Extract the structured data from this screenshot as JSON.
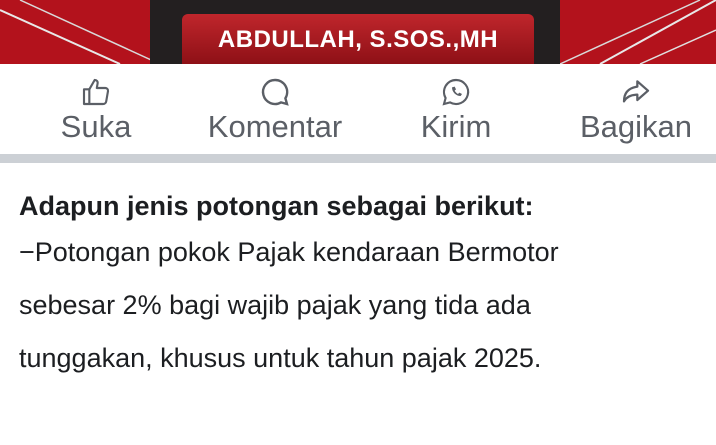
{
  "banner": {
    "name": "ABDULLAH, S.SOS.,MH"
  },
  "actions": [
    {
      "label": "Suka",
      "icon": "thumbs-up-icon"
    },
    {
      "label": "Komentar",
      "icon": "comment-bubble-icon"
    },
    {
      "label": "Kirim",
      "icon": "whatsapp-icon"
    },
    {
      "label": "Bagikan",
      "icon": "share-arrow-icon"
    }
  ],
  "post": {
    "heading": "Adapun jenis potongan sebagai berikut:",
    "lines": [
      "−Potongan pokok Pajak kendaraan Bermotor",
      "sebesar 2% bagi wajib pajak yang tida ada",
      "tunggakan, khusus untuk tahun pajak 2025."
    ]
  },
  "colors": {
    "banner_red": "#b3121c",
    "icon_gray": "#5b5f66",
    "divider": "#ccd0d5",
    "text": "#1c1e21"
  }
}
